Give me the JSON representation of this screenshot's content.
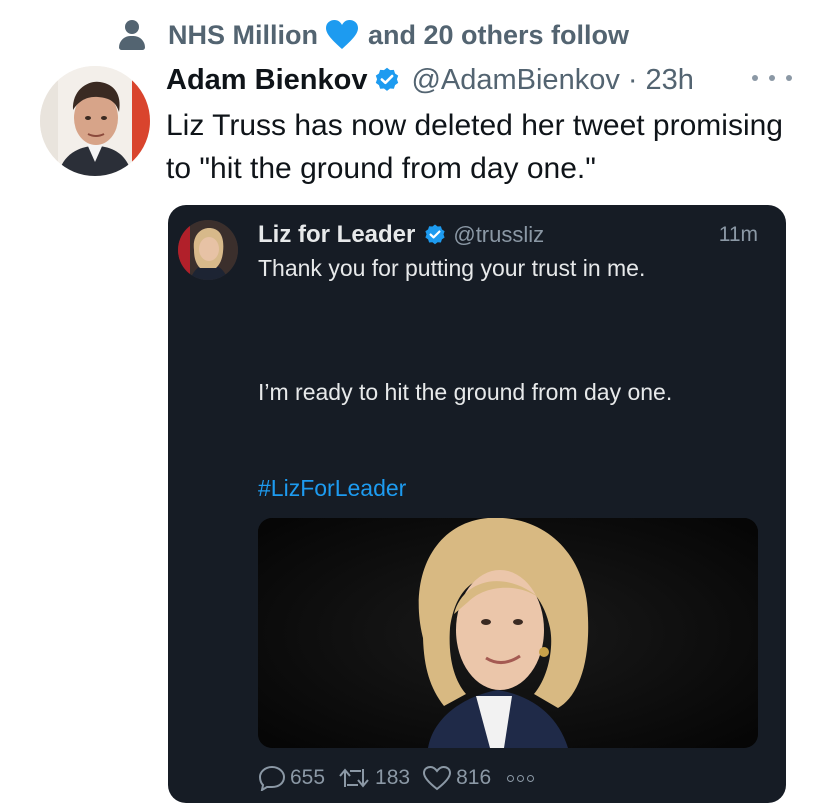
{
  "social_context": {
    "name": "NHS Million",
    "rest": "and 20 others follow",
    "heart_color": "#1d9bf0"
  },
  "tweet": {
    "author_name": "Adam Bienkov",
    "author_handle": "@AdamBienkov",
    "time": "23h",
    "separator": "·",
    "text": "Liz Truss has now deleted her tweet promising to \"hit the ground from day one.\""
  },
  "quoted_tweet": {
    "author_name": "Liz for Leader",
    "author_handle": "@trussliz",
    "time": "11m",
    "line1": "Thank you for putting your trust in me.",
    "line2": "I’m ready to hit the ground from day one.",
    "hashtag": "#LizForLeader",
    "replies": "655",
    "retweets": "183",
    "likes": "816"
  },
  "colors": {
    "verified": "#1d9bf0",
    "card_background": "#161c25",
    "link": "#1d9bf0"
  },
  "icons": [
    "person-icon",
    "blue-heart-icon",
    "verified-icon",
    "more-icon",
    "reply-icon",
    "retweet-icon",
    "like-icon"
  ]
}
